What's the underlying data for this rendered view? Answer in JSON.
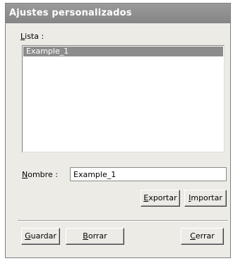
{
  "dialog": {
    "title": "Ajustes personalizados"
  },
  "list": {
    "label_accel": "L",
    "label_rest": "ista :",
    "items": [
      "Example_1"
    ],
    "selected": "Example_1"
  },
  "name": {
    "label_accel": "N",
    "label_rest": "ombre :",
    "value": "Example_1"
  },
  "buttons": {
    "exportar": {
      "accel": "E",
      "rest": "xportar"
    },
    "importar": {
      "accel": "I",
      "rest": "mportar"
    },
    "guardar": {
      "accel": "G",
      "rest": "uardar"
    },
    "borrar": {
      "accel": "B",
      "rest": "orrar"
    },
    "cerrar": {
      "accel": "C",
      "rest": "errar"
    }
  }
}
